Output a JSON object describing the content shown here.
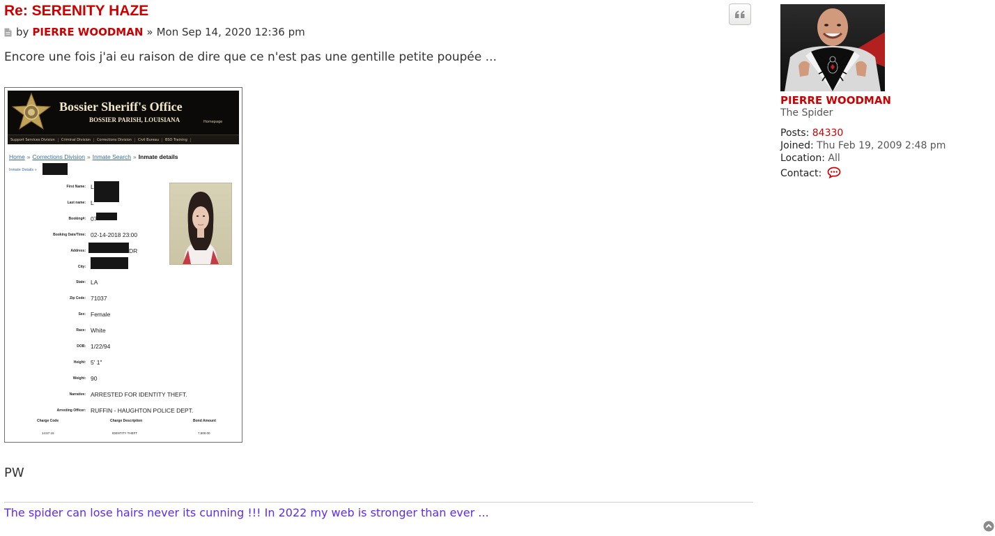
{
  "post": {
    "title": "Re: SERENITY HAZE",
    "by_label": "by",
    "author": "PIERRE WOODMAN",
    "date_separator": "»",
    "date": "Mon Sep 14, 2020 12:36 pm",
    "body_text": "Encore une fois j'ai eu raison de dire que ce n'est pas une gentille petite poupée ...",
    "closing": "PW",
    "signature": "The spider can lose hairs never its cunning !!! In 2022 my web is stronger than ever ...",
    "icons": {
      "post": "post-file-icon",
      "quote": "quote-icon",
      "back_to_top": "chevron-up-circle-icon"
    }
  },
  "attachment": {
    "banner_title": "Bossier Sheriff's Office",
    "banner_subtitle": "BOSSIER PARISH, LOUISIANA",
    "banner_home": "Homepage",
    "nav": [
      "Support Services Division",
      "Criminal Division",
      "Corrections Division",
      "Civil Bureau",
      "BSO Training"
    ],
    "breadcrumbs": [
      "Home",
      "Corrections Division",
      "Inmate Search"
    ],
    "breadcrumb_current": "Inmate details",
    "breadcrumb2": "Inmate Details »",
    "fields": [
      {
        "label": "First Name:",
        "value": "L"
      },
      {
        "label": "Last name:",
        "value": "L"
      },
      {
        "label": "Booking#:",
        "value": "07"
      },
      {
        "label": "Booking Date/Time:",
        "value": "02-14-2018 23:00"
      },
      {
        "label": "Address:",
        "value": "DR"
      },
      {
        "label": "City:",
        "value": ""
      },
      {
        "label": "State:",
        "value": "LA"
      },
      {
        "label": "Zip Code:",
        "value": "71037"
      },
      {
        "label": "Sex:",
        "value": "Female"
      },
      {
        "label": "Race:",
        "value": "White"
      },
      {
        "label": "DOB:",
        "value": "1/22/94"
      },
      {
        "label": "Height:",
        "value": "5' 1\""
      },
      {
        "label": "Weight:",
        "value": "90"
      },
      {
        "label": "Narrative:",
        "value": "ARRESTED FOR IDENTITY THEFT."
      },
      {
        "label": "Arresting Officer:",
        "value": "RUFFIN - HAUGHTON POLICE DEPT."
      }
    ],
    "charges": {
      "headers": [
        "Charge Code",
        "Charge Description",
        "Bond Amount"
      ],
      "values": [
        "14:67.16",
        "IDENTITY THEFT",
        "7,500.00"
      ]
    }
  },
  "profile": {
    "name": "PIERRE WOODMAN",
    "rank": "The Spider",
    "posts_label": "Posts:",
    "posts": "84330",
    "joined_label": "Joined:",
    "joined": "Thu Feb 19, 2009 2:48 pm",
    "location_label": "Location:",
    "location": "All",
    "contact_label": "Contact:",
    "contact_icon": "speech-bubble-icon"
  },
  "colors": {
    "accent_red": "#cc0000",
    "signature_purple": "#5c29ff",
    "text": "#333333"
  }
}
